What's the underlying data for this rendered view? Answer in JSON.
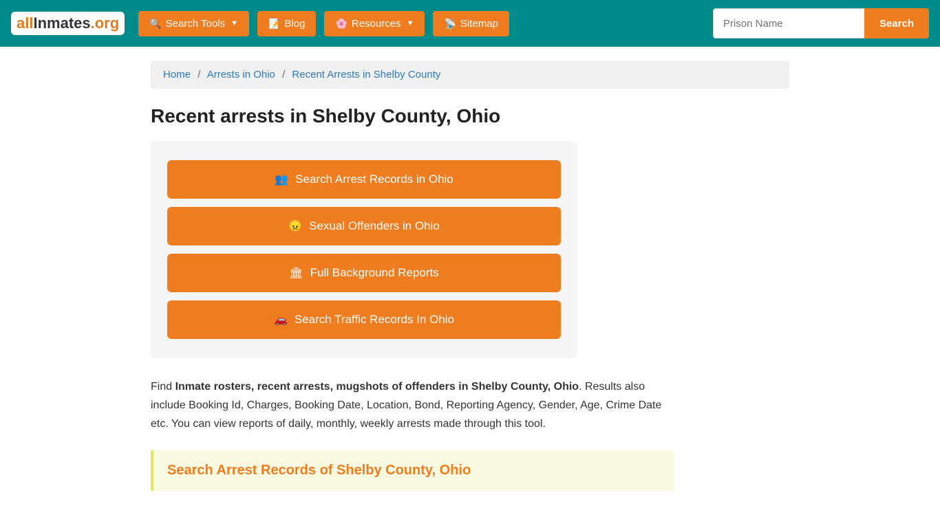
{
  "brand": {
    "logo_all": "all",
    "logo_inmates": "Inmates",
    "logo_org": ".org"
  },
  "navbar": {
    "search_tools_label": "Search Tools",
    "blog_label": "Blog",
    "resources_label": "Resources",
    "sitemap_label": "Sitemap",
    "prison_placeholder": "Prison Name",
    "search_btn_label": "Search"
  },
  "breadcrumb": {
    "home": "Home",
    "arrests_ohio": "Arrests in Ohio",
    "current": "Recent Arrests in Shelby County"
  },
  "page": {
    "title": "Recent arrests in Shelby County, Ohio",
    "buttons": [
      {
        "id": "arrest-records",
        "icon": "people",
        "label": "Search Arrest Records in Ohio"
      },
      {
        "id": "sexual-offenders",
        "icon": "offender",
        "label": "Sexual Offenders in Ohio"
      },
      {
        "id": "background-reports",
        "icon": "bg",
        "label": "Full Background Reports"
      },
      {
        "id": "traffic-records",
        "icon": "car",
        "label": "Search Traffic Records In Ohio"
      }
    ],
    "description_pre": "Find ",
    "description_bold": "Inmate rosters, recent arrests, mugshots of offenders in Shelby County, Ohio",
    "description_post": ". Results also include Booking Id, Charges, Booking Date, Location, Bond, Reporting Agency, Gender, Age, Crime Date etc. You can view reports of daily, monthly, weekly arrests made through this tool.",
    "search_records_title": "Search Arrest Records of Shelby County, Ohio"
  }
}
